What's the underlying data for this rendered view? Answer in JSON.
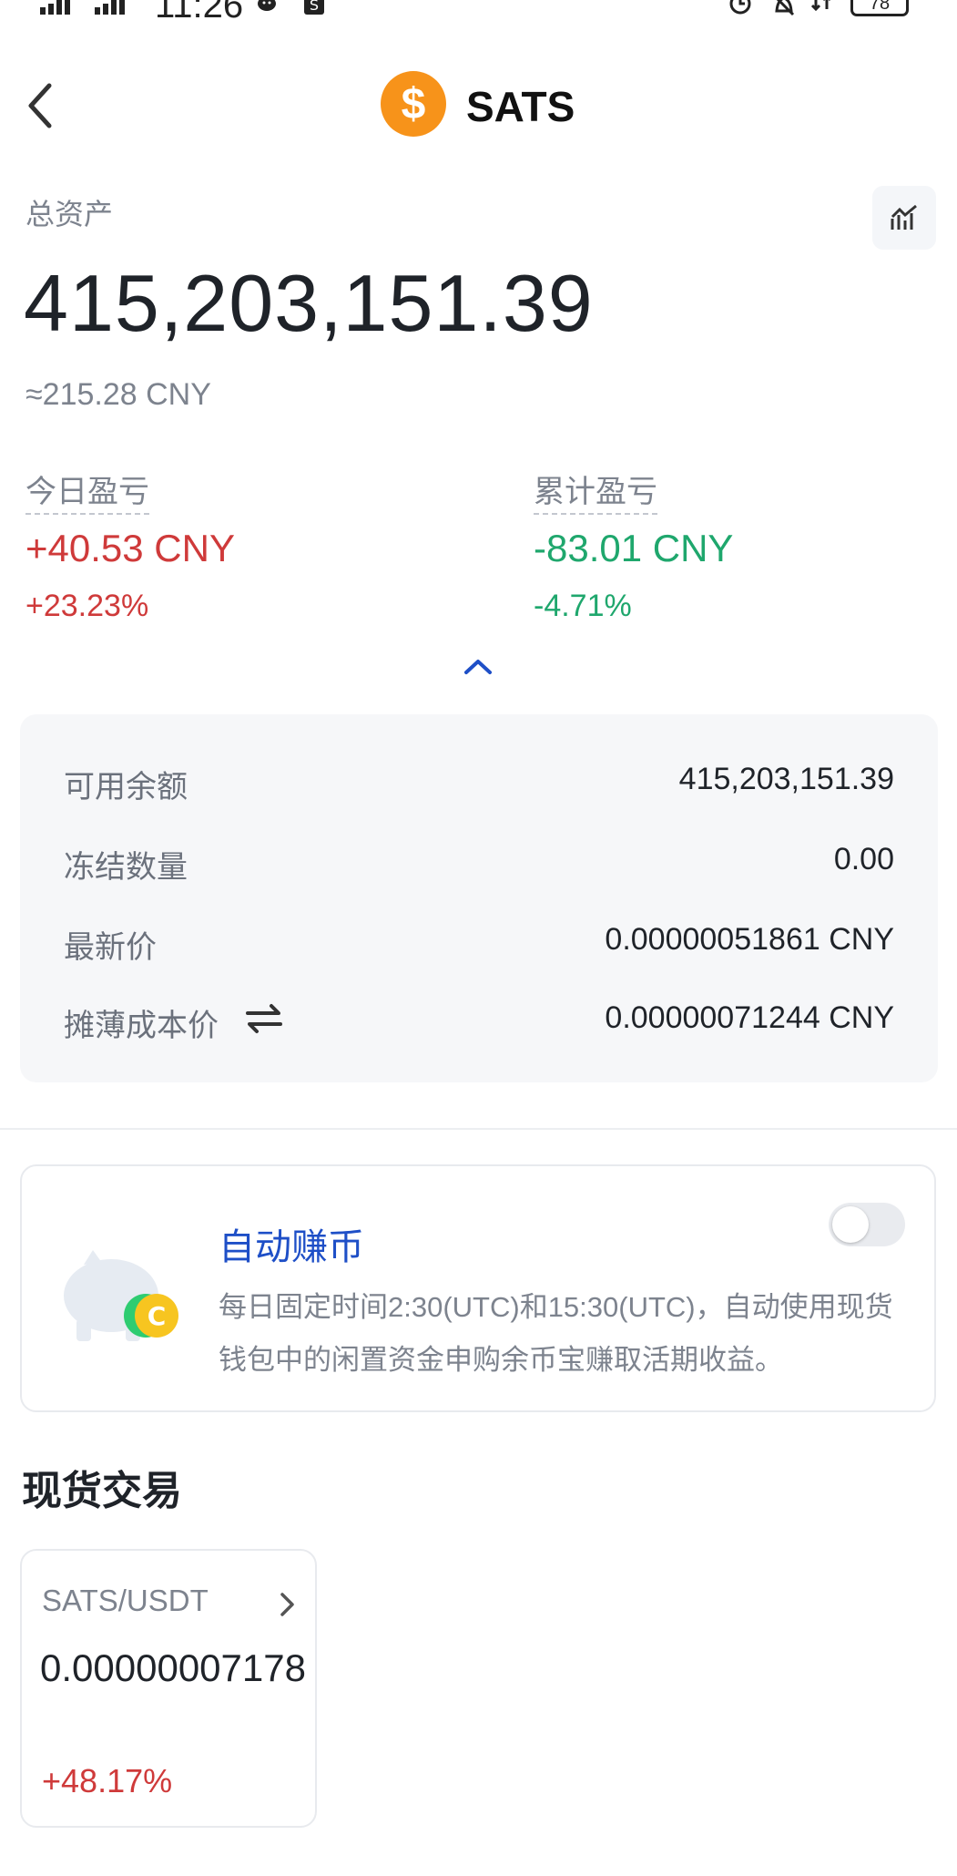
{
  "status_bar": {
    "time": "11:26",
    "battery": "78"
  },
  "header": {
    "coin_symbol": "$",
    "coin_name": "SATS"
  },
  "summary": {
    "total_label": "总资产",
    "total_value": "415,203,151.39",
    "total_cny": "≈215.28 CNY"
  },
  "pnl": {
    "today": {
      "label": "今日盈亏",
      "value": "+40.53 CNY",
      "pct": "+23.23%"
    },
    "cumulative": {
      "label": "累计盈亏",
      "value": "-83.01 CNY",
      "pct": "-4.71%"
    }
  },
  "details": [
    {
      "label": "可用余额",
      "value": "415,203,151.39"
    },
    {
      "label": "冻结数量",
      "value": "0.00"
    },
    {
      "label": "最新价",
      "value": "0.00000051861 CNY"
    },
    {
      "label": "摊薄成本价",
      "value": "0.00000071244 CNY"
    }
  ],
  "auto_earn": {
    "title": "自动赚币",
    "description": "每日固定时间2:30(UTC)和15:30(UTC)，自动使用现货钱包中的闲置资金申购余币宝赚取活期收益。",
    "enabled": false
  },
  "spot": {
    "section_title": "现货交易",
    "pair": "SATS/USDT",
    "price": "0.00000007178",
    "change": "+48.17%"
  },
  "colors": {
    "positive": "#cf3a3a",
    "negative": "#1fa76d",
    "accent": "#1e4fc7",
    "coin": "#f7931a"
  }
}
